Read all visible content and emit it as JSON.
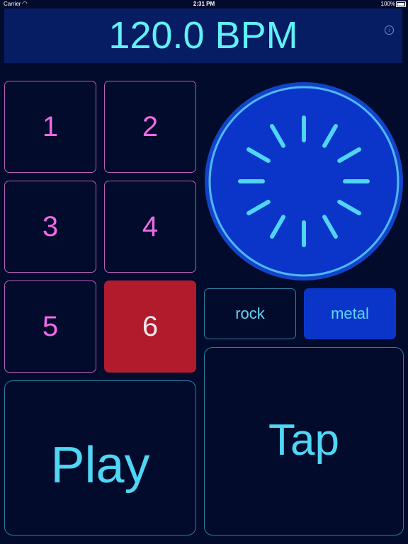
{
  "status_bar": {
    "carrier": "Carrier",
    "time": "2:31 PM",
    "battery": "100%"
  },
  "header": {
    "bpm": "120.0 BPM",
    "info_glyph": "i"
  },
  "pads": [
    {
      "label": "1",
      "active": false
    },
    {
      "label": "2",
      "active": false
    },
    {
      "label": "3",
      "active": false
    },
    {
      "label": "4",
      "active": false
    },
    {
      "label": "5",
      "active": false
    },
    {
      "label": "6",
      "active": true
    }
  ],
  "dial": {
    "icon": "tempo-dial-icon",
    "tick_count": 12,
    "colors": {
      "outer": "#1243c9",
      "ring": "#4fb8f5",
      "inner": "#0a35c8",
      "ticks": "#4fd6f5"
    }
  },
  "styles": {
    "rock_label": "rock",
    "metal_label": "metal",
    "selected": "metal"
  },
  "controls": {
    "play_label": "Play",
    "tap_label": "Tap"
  },
  "colors": {
    "background": "#020b2b",
    "header_bg": "#061c63",
    "bpm_text": "#5ff2f8",
    "pad_text": "#f06ae6",
    "pad_border": "#b75fb8",
    "active_pad": "#b21b2c",
    "button_text": "#4fd6f5"
  }
}
